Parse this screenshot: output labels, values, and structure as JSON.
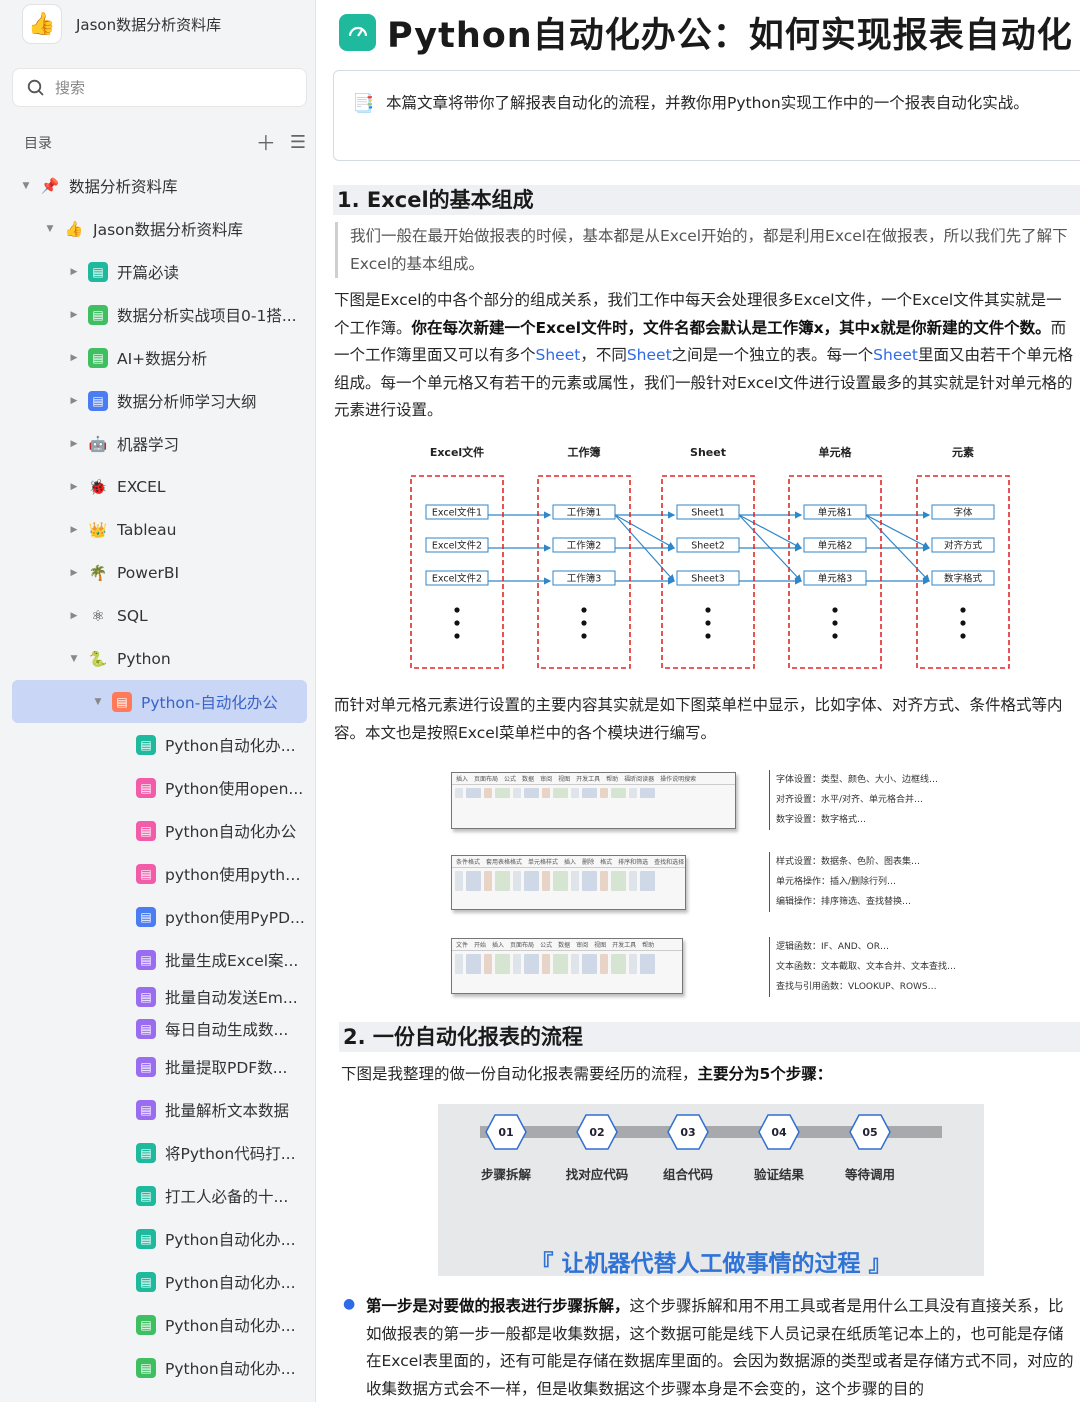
{
  "sidebar": {
    "app_title": "Jason数据分析资料库",
    "search_placeholder": "搜索",
    "toc_label": "目录",
    "items": [
      {
        "label": "数据分析资料库",
        "icon": "pin-icon"
      },
      {
        "label": "Jason数据分析资料库",
        "icon": "thumbs-up-icon"
      },
      {
        "label": "开篇必读",
        "icon": "teal-doc-icon"
      },
      {
        "label": "数据分析实战项目0-1搭...",
        "icon": "green-doc-icon"
      },
      {
        "label": "AI+数据分析",
        "icon": "green-doc-icon"
      },
      {
        "label": "数据分析师学习大纲",
        "icon": "blue-doc-icon"
      },
      {
        "label": "机器学习",
        "icon": "robot-icon"
      },
      {
        "label": "EXCEL",
        "icon": "bug-icon"
      },
      {
        "label": "Tableau",
        "icon": "crown-icon"
      },
      {
        "label": "PowerBI",
        "icon": "palm-icon"
      },
      {
        "label": "SQL",
        "icon": "molecule-icon"
      },
      {
        "label": "Python",
        "icon": "snake-icon"
      },
      {
        "label": "Python-自动化办公",
        "icon": "orange-doc-icon"
      },
      {
        "label": "Python自动化办...",
        "icon": "teal-doc-icon"
      },
      {
        "label": "Python使用open...",
        "icon": "pink-doc-icon"
      },
      {
        "label": "Python自动化办公",
        "icon": "pink-doc-icon"
      },
      {
        "label": "python使用pytho...",
        "icon": "pink-doc-icon"
      },
      {
        "label": "python使用PyPD...",
        "icon": "blue-doc-icon"
      },
      {
        "label": "批量生成Excel案...",
        "icon": "purple-doc-icon"
      },
      {
        "label": "批量自动发送Em...",
        "icon": "purple-doc-icon"
      },
      {
        "label": "每日自动生成数...",
        "icon": "purple-doc-icon"
      },
      {
        "label": "批量提取PDF数...",
        "icon": "purple-doc-icon"
      },
      {
        "label": "批量解析文本数据",
        "icon": "purple-doc-icon"
      },
      {
        "label": "将Python代码打...",
        "icon": "teal-doc-icon"
      },
      {
        "label": "打工人必备的十...",
        "icon": "teal-doc-icon"
      },
      {
        "label": "Python自动化办...",
        "icon": "teal-doc-icon"
      },
      {
        "label": "Python自动化办...",
        "icon": "teal-doc-icon"
      },
      {
        "label": "Python自动化办...",
        "icon": "green-doc-icon"
      },
      {
        "label": "Python自动化办...",
        "icon": "green-doc-icon"
      }
    ]
  },
  "article": {
    "title": "Python自动化办公：如何实现报表自动化",
    "summary": "本篇文章将带你了解报表自动化的流程，并教你用Python实现工作中的一个报表自动化实战。",
    "h1": "1. Excel的基本组成",
    "quote": "我们一般在最开始做报表的时候，基本都是从Excel开始的，都是利用Excel在做报表，所以我们先了解下Excel的基本组成。",
    "p1_a": "下图是Excel的中各个部分的组成关系，我们工作中每天会处理很多Excel文件，一个Excel文件其实就是一个工作簿。",
    "p1_b": "你在每次新建一个Excel文件时，文件名都会默认是工作簿x，其中x就是你新建的文件个数。",
    "p1_c": "而一个工作簿里面又可以有多个",
    "p1_sheet": "Sheet",
    "p1_d": "，不同",
    "p1_e": "之间是一个独立的表。每一个",
    "p1_f": "里面又由若干个单元格组成。每一个单元格又有若干的元素或属性，我们一般针对Excel文件进行设置最多的其实就是针对单元格的元素进行设置。",
    "p2": "而针对单元格元素进行设置的主要内容其实就是如下图菜单栏中显示，比如字体、对齐方式、条件格式等内容。本文也是按照Excel菜单栏中的各个模块进行编写。",
    "h2": "2. 一份自动化报表的流程",
    "p3_a": "下图是我整理的做一份自动化报表需要经历的流程，",
    "p3_b": "主要分为5个步骤：",
    "bullet_bold": "第一步是对要做的报表进行步骤拆解，",
    "bullet_text": "这个步骤拆解和用不用工具或者是用什么工具没有直接关系，比如做报表的第一步一般都是收集数据，这个数据可能是线下人员记录在纸质笔记本上的，也可能是存储在Excel表里面的，还有可能是存储在数据库里面的。会因为数据源的类型或者是存储方式不同，对应的收集数据方式会不一样，但是收集数据这个步骤本身是不会变的，这个步骤的目的"
  },
  "excel_diagram": {
    "columns": [
      {
        "header": "Excel文件",
        "items": [
          "Excel文件1",
          "Excel文件2",
          "Excel文件2"
        ]
      },
      {
        "header": "工作簿",
        "items": [
          "工作簿1",
          "工作簿2",
          "工作簿3"
        ]
      },
      {
        "header": "Sheet",
        "items": [
          "Sheet1",
          "Sheet2",
          "Sheet3"
        ]
      },
      {
        "header": "单元格",
        "items": [
          "单元格1",
          "单元格2",
          "单元格3"
        ]
      },
      {
        "header": "元素",
        "items": [
          "字体",
          "对齐方式",
          "数字格式"
        ]
      }
    ]
  },
  "ribbons": [
    {
      "tabs": [
        "插入",
        "页面布局",
        "公式",
        "数据",
        "审阅",
        "视图",
        "开发工具",
        "帮助",
        "福昕阅读器",
        "操作说明搜索"
      ],
      "notes": [
        "字体设置：类型、颜色、大小、边框线…",
        "对齐设置：水平/对齐、单元格合并…",
        "数字设置：数字格式…"
      ]
    },
    {
      "tabs": [
        "条件格式",
        "套用表格格式",
        "单元格样式",
        "插入",
        "删除",
        "格式",
        "排序和筛选",
        "查找和选择"
      ],
      "notes": [
        "样式设置：数据条、色阶、图表集…",
        "单元格操作：插入/删除行列…",
        "编辑操作：排序筛选、查找替换…"
      ]
    },
    {
      "tabs": [
        "文件",
        "开始",
        "插入",
        "页面布局",
        "公式",
        "数据",
        "审阅",
        "视图",
        "开发工具",
        "帮助"
      ],
      "notes": [
        "逻辑函数：IF、AND、OR…",
        "文本函数：文本截取、文本合并、文本查找…",
        "查找与引用函数：VLOOKUP、ROWS…"
      ]
    }
  ],
  "flow": {
    "steps": [
      {
        "num": "01",
        "label": "步骤拆解"
      },
      {
        "num": "02",
        "label": "找对应代码"
      },
      {
        "num": "03",
        "label": "组合代码"
      },
      {
        "num": "04",
        "label": "验证结果"
      },
      {
        "num": "05",
        "label": "等待调用"
      }
    ],
    "slogan": "『 让机器代替人工做事情的过程 』"
  }
}
